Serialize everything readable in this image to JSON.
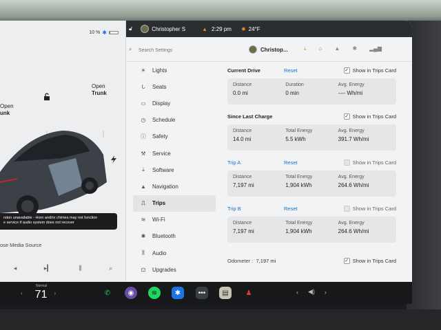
{
  "status_bar": {
    "user_name": "Christopher S",
    "time": "2:29 pm",
    "temperature": "24°F"
  },
  "car_panel": {
    "battery_percent": "10 %",
    "battery_level": 0.1,
    "open_trunk_left": [
      "Open",
      "unk"
    ],
    "open_trunk_right": [
      "Open",
      "Trunk"
    ],
    "warning_lines": [
      "rston unavailable - Horn and/or chimes may not function",
      "e service if audio system does not recover"
    ],
    "media_source": "ose Media Source"
  },
  "settings_header": {
    "search_placeholder": "Search Settings",
    "user_short": "Christop..."
  },
  "nav": {
    "items": [
      {
        "label": "Lights",
        "icon": "lights-icon"
      },
      {
        "label": "Seats",
        "icon": "seat-icon"
      },
      {
        "label": "Display",
        "icon": "display-icon"
      },
      {
        "label": "Schedule",
        "icon": "schedule-icon"
      },
      {
        "label": "Safety",
        "icon": "safety-icon"
      },
      {
        "label": "Service",
        "icon": "wrench-icon"
      },
      {
        "label": "Software",
        "icon": "download-icon"
      },
      {
        "label": "Navigation",
        "icon": "navigation-icon"
      },
      {
        "label": "Trips",
        "icon": "trips-icon",
        "active": true
      },
      {
        "label": "Wi-Fi",
        "icon": "wifi-icon"
      },
      {
        "label": "Bluetooth",
        "icon": "bluetooth-icon"
      },
      {
        "label": "Audio",
        "icon": "audio-icon"
      },
      {
        "label": "Upgrades",
        "icon": "upgrades-icon"
      }
    ]
  },
  "trips": {
    "show_in_trips_card_label": "Show in Trips Card",
    "reset_label": "Reset",
    "labels": {
      "distance": "Distance",
      "duration": "Duration",
      "avg_energy": "Avg. Energy",
      "total_energy": "Total Energy"
    },
    "current_drive": {
      "title": "Current Drive",
      "show_in_card": true,
      "distance": "0.0 mi",
      "duration": "0 min",
      "avg_energy": "---- Wh/mi"
    },
    "since_last_charge": {
      "title": "Since Last Charge",
      "show_in_card": true,
      "distance": "14.0 mi",
      "total_energy": "5.5 kWh",
      "avg_energy": "391.7 Wh/mi"
    },
    "trip_a": {
      "title": "Trip A",
      "show_in_card": false,
      "distance": "7,197 mi",
      "total_energy": "1,904 kWh",
      "avg_energy": "264.6 Wh/mi"
    },
    "trip_b": {
      "title": "Trip B",
      "show_in_card": false,
      "distance": "7,197 mi",
      "total_energy": "1,904 kWh",
      "avg_energy": "264.6 Wh/mi"
    },
    "odometer": {
      "label": "Odometer :",
      "value": "7,197 mi",
      "show_in_card": true
    }
  },
  "dock": {
    "temp_label": "Normal",
    "temp_value": "71"
  },
  "colors": {
    "accent_blue": "#1a6fd1",
    "dock_bg": "#16181a",
    "status_bar_bg": "#2b2e31"
  }
}
